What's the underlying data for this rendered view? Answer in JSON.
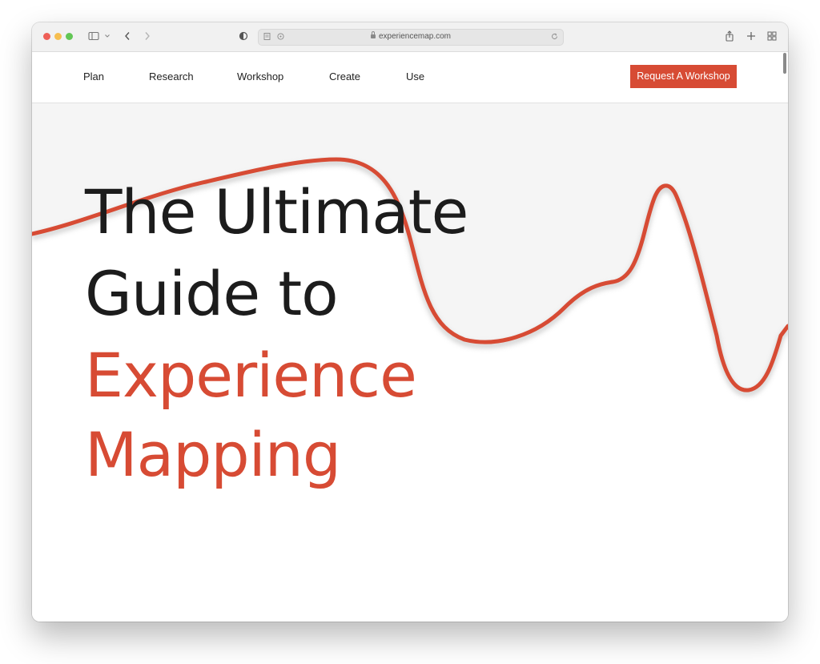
{
  "browser": {
    "url": "experiencemap.com",
    "icons": {
      "sidebar": "sidebar-icon",
      "back": "chevron-left-icon",
      "forward": "chevron-right-icon",
      "privacy": "shield-half-icon",
      "reader": "reader-icon",
      "reload": "reload-icon",
      "share": "share-icon",
      "new_tab": "plus-icon",
      "tabs": "tab-grid-icon"
    }
  },
  "nav": {
    "items": [
      {
        "label": "Plan"
      },
      {
        "label": "Research"
      },
      {
        "label": "Workshop"
      },
      {
        "label": "Create"
      },
      {
        "label": "Use"
      }
    ],
    "cta_label": "Request A Workshop"
  },
  "hero": {
    "title_line1": "The Ultimate",
    "title_line2": "Guide to",
    "title_line3": "Experience",
    "title_line4": "Mapping"
  },
  "colors": {
    "accent": "#d74b34",
    "text": "#1c1c1c",
    "hero_bg_gray": "#f5f5f5"
  }
}
